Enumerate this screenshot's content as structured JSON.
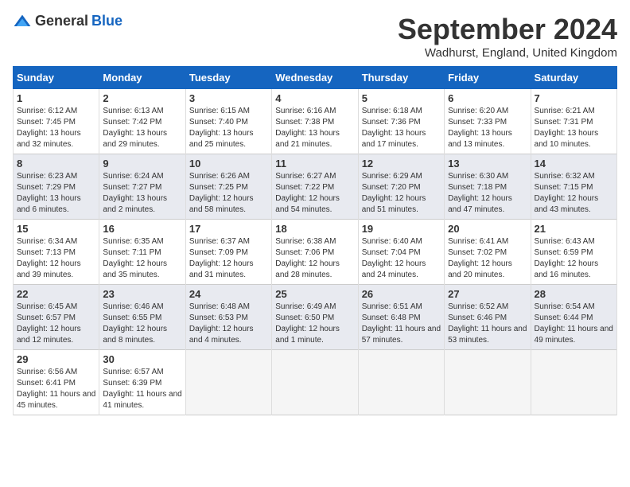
{
  "header": {
    "logo_general": "General",
    "logo_blue": "Blue",
    "month_title": "September 2024",
    "location": "Wadhurst, England, United Kingdom"
  },
  "days_of_week": [
    "Sunday",
    "Monday",
    "Tuesday",
    "Wednesday",
    "Thursday",
    "Friday",
    "Saturday"
  ],
  "weeks": [
    [
      {
        "day": "1",
        "sunrise": "6:12 AM",
        "sunset": "7:45 PM",
        "daylight": "13 hours and 32 minutes."
      },
      {
        "day": "2",
        "sunrise": "6:13 AM",
        "sunset": "7:42 PM",
        "daylight": "13 hours and 29 minutes."
      },
      {
        "day": "3",
        "sunrise": "6:15 AM",
        "sunset": "7:40 PM",
        "daylight": "13 hours and 25 minutes."
      },
      {
        "day": "4",
        "sunrise": "6:16 AM",
        "sunset": "7:38 PM",
        "daylight": "13 hours and 21 minutes."
      },
      {
        "day": "5",
        "sunrise": "6:18 AM",
        "sunset": "7:36 PM",
        "daylight": "13 hours and 17 minutes."
      },
      {
        "day": "6",
        "sunrise": "6:20 AM",
        "sunset": "7:33 PM",
        "daylight": "13 hours and 13 minutes."
      },
      {
        "day": "7",
        "sunrise": "6:21 AM",
        "sunset": "7:31 PM",
        "daylight": "13 hours and 10 minutes."
      }
    ],
    [
      {
        "day": "8",
        "sunrise": "6:23 AM",
        "sunset": "7:29 PM",
        "daylight": "13 hours and 6 minutes."
      },
      {
        "day": "9",
        "sunrise": "6:24 AM",
        "sunset": "7:27 PM",
        "daylight": "13 hours and 2 minutes."
      },
      {
        "day": "10",
        "sunrise": "6:26 AM",
        "sunset": "7:25 PM",
        "daylight": "12 hours and 58 minutes."
      },
      {
        "day": "11",
        "sunrise": "6:27 AM",
        "sunset": "7:22 PM",
        "daylight": "12 hours and 54 minutes."
      },
      {
        "day": "12",
        "sunrise": "6:29 AM",
        "sunset": "7:20 PM",
        "daylight": "12 hours and 51 minutes."
      },
      {
        "day": "13",
        "sunrise": "6:30 AM",
        "sunset": "7:18 PM",
        "daylight": "12 hours and 47 minutes."
      },
      {
        "day": "14",
        "sunrise": "6:32 AM",
        "sunset": "7:15 PM",
        "daylight": "12 hours and 43 minutes."
      }
    ],
    [
      {
        "day": "15",
        "sunrise": "6:34 AM",
        "sunset": "7:13 PM",
        "daylight": "12 hours and 39 minutes."
      },
      {
        "day": "16",
        "sunrise": "6:35 AM",
        "sunset": "7:11 PM",
        "daylight": "12 hours and 35 minutes."
      },
      {
        "day": "17",
        "sunrise": "6:37 AM",
        "sunset": "7:09 PM",
        "daylight": "12 hours and 31 minutes."
      },
      {
        "day": "18",
        "sunrise": "6:38 AM",
        "sunset": "7:06 PM",
        "daylight": "12 hours and 28 minutes."
      },
      {
        "day": "19",
        "sunrise": "6:40 AM",
        "sunset": "7:04 PM",
        "daylight": "12 hours and 24 minutes."
      },
      {
        "day": "20",
        "sunrise": "6:41 AM",
        "sunset": "7:02 PM",
        "daylight": "12 hours and 20 minutes."
      },
      {
        "day": "21",
        "sunrise": "6:43 AM",
        "sunset": "6:59 PM",
        "daylight": "12 hours and 16 minutes."
      }
    ],
    [
      {
        "day": "22",
        "sunrise": "6:45 AM",
        "sunset": "6:57 PM",
        "daylight": "12 hours and 12 minutes."
      },
      {
        "day": "23",
        "sunrise": "6:46 AM",
        "sunset": "6:55 PM",
        "daylight": "12 hours and 8 minutes."
      },
      {
        "day": "24",
        "sunrise": "6:48 AM",
        "sunset": "6:53 PM",
        "daylight": "12 hours and 4 minutes."
      },
      {
        "day": "25",
        "sunrise": "6:49 AM",
        "sunset": "6:50 PM",
        "daylight": "12 hours and 1 minute."
      },
      {
        "day": "26",
        "sunrise": "6:51 AM",
        "sunset": "6:48 PM",
        "daylight": "11 hours and 57 minutes."
      },
      {
        "day": "27",
        "sunrise": "6:52 AM",
        "sunset": "6:46 PM",
        "daylight": "11 hours and 53 minutes."
      },
      {
        "day": "28",
        "sunrise": "6:54 AM",
        "sunset": "6:44 PM",
        "daylight": "11 hours and 49 minutes."
      }
    ],
    [
      {
        "day": "29",
        "sunrise": "6:56 AM",
        "sunset": "6:41 PM",
        "daylight": "11 hours and 45 minutes."
      },
      {
        "day": "30",
        "sunrise": "6:57 AM",
        "sunset": "6:39 PM",
        "daylight": "11 hours and 41 minutes."
      },
      null,
      null,
      null,
      null,
      null
    ]
  ]
}
